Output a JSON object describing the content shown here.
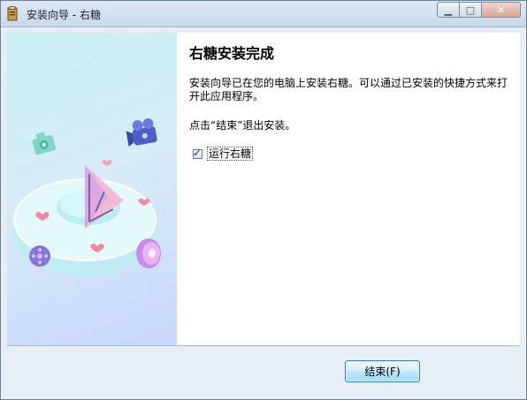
{
  "window": {
    "title": "安装向导 - 右糖"
  },
  "page": {
    "heading": "右糖安装完成",
    "description": "安装向导已在您的电脑上安装右糖。可以通过已安装的快捷方式来打开此应用程序。",
    "instruction": "点击“结束”退出安装。",
    "checkbox": {
      "label": "运行右糖",
      "checked": true
    }
  },
  "buttons": {
    "finish": "结束(F)"
  },
  "colors": {
    "accent": "#3c7fb1",
    "sidebar_top": "#c9f0f4",
    "sidebar_bottom": "#c8d7fb"
  },
  "icons": [
    "installer-app-icon",
    "minimize-icon",
    "maximize-icon",
    "close-icon",
    "camera-icon",
    "video-camera-icon",
    "play-logo-icon",
    "heart-icon",
    "film-reel-icon",
    "disc-icon"
  ]
}
